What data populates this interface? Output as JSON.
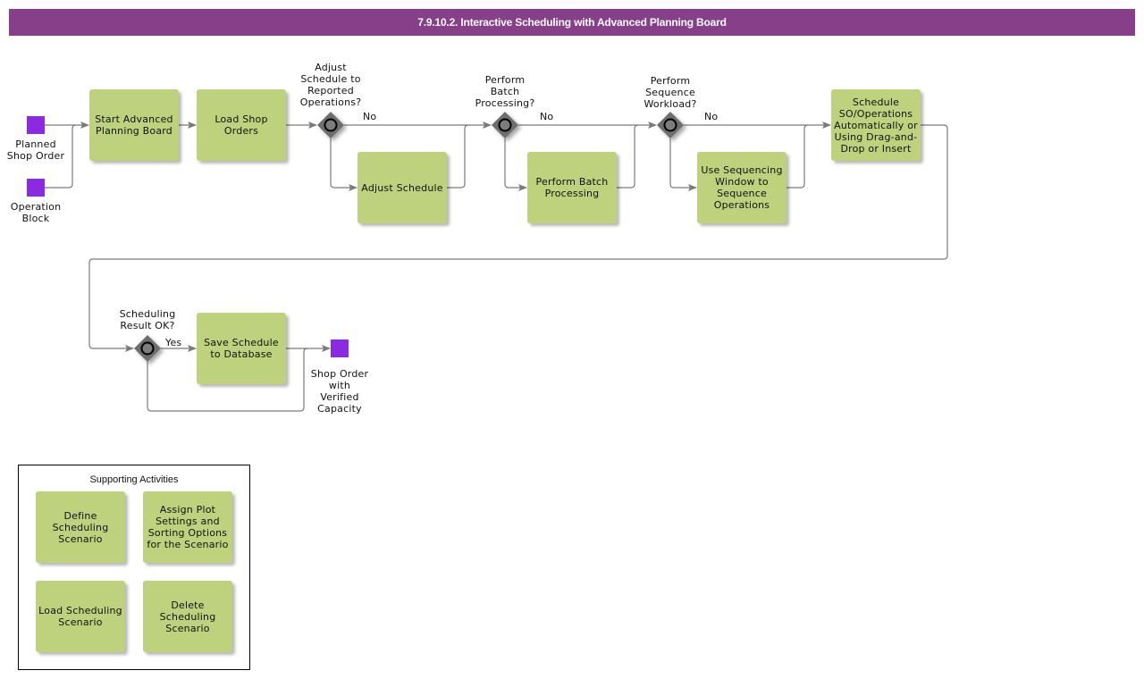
{
  "header": {
    "title": "7.9.10.2. Interactive Scheduling with Advanced Planning Board"
  },
  "colors": {
    "title_bar": "#873f8a",
    "task": "#bed27e",
    "event": "#8a2be2",
    "gateway": "#6e6e6e",
    "connector": "#808080"
  },
  "events": {
    "planned_shop_order": {
      "label": "Planned Shop Order",
      "lines": [
        "Planned",
        "Shop Order"
      ]
    },
    "operation_block": {
      "label": "Operation Block",
      "lines": [
        "Operation",
        "Block"
      ]
    },
    "end": {
      "label": "Shop Order with Verified Capacity",
      "lines": [
        "Shop Order",
        "with",
        "Verified",
        "Capacity"
      ]
    }
  },
  "tasks": {
    "start_apb": {
      "lines": [
        "Start Advanced",
        "Planning Board"
      ]
    },
    "load_shop_orders": {
      "lines": [
        "Load Shop",
        "Orders"
      ]
    },
    "adjust_schedule": {
      "lines": [
        "Adjust Schedule"
      ]
    },
    "perform_batch": {
      "lines": [
        "Perform Batch",
        "Processing"
      ]
    },
    "use_sequencing": {
      "lines": [
        "Use Sequencing",
        "Window to",
        "Sequence",
        "Operations"
      ]
    },
    "schedule_so": {
      "lines": [
        "Schedule",
        "SO/Operations",
        "Automatically or",
        "Using Drag-and-",
        "Drop or Insert"
      ]
    },
    "save_schedule": {
      "lines": [
        "Save Schedule",
        "to Database"
      ]
    }
  },
  "gateways": {
    "adjust_reported": {
      "question": [
        "Adjust",
        "Schedule to",
        "Reported",
        "Operations?"
      ],
      "branch_label": "No"
    },
    "batch": {
      "question": [
        "Perform",
        "Batch",
        "Processing?"
      ],
      "branch_label": "No"
    },
    "sequence": {
      "question": [
        "Perform",
        "Sequence",
        "Workload?"
      ],
      "branch_label": "No"
    },
    "result_ok": {
      "question": [
        "Scheduling",
        "Result OK?"
      ],
      "branch_label": "Yes"
    }
  },
  "supporting": {
    "title": "Supporting Activities",
    "items": [
      {
        "lines": [
          "Define",
          "Scheduling",
          "Scenario"
        ]
      },
      {
        "lines": [
          "Assign Plot",
          "Settings and",
          "Sorting Options",
          "for the Scenario"
        ]
      },
      {
        "lines": [
          "Load Scheduling",
          "Scenario"
        ]
      },
      {
        "lines": [
          "Delete",
          "Scheduling",
          "Scenario"
        ]
      }
    ]
  }
}
